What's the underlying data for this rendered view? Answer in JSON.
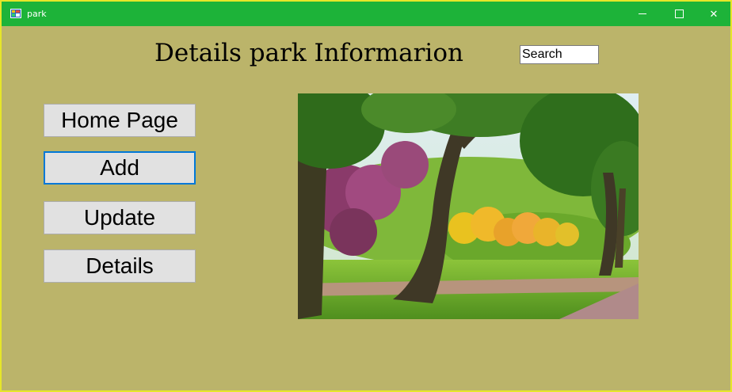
{
  "window": {
    "title": "park",
    "controls": {
      "minimize": "minimize-icon",
      "maximize": "maximize-icon",
      "close": "close-icon"
    }
  },
  "main": {
    "heading": "Details park Informarion",
    "search": {
      "value": "Search"
    },
    "buttons": {
      "home": "Home Page",
      "add": "Add",
      "update": "Update",
      "details": "Details"
    },
    "image": {
      "subject": "park-photo"
    }
  },
  "colors": {
    "titlebar": "#1db339",
    "background": "#bbb46a",
    "button": "#e1e1e1",
    "focus": "#0078d7"
  }
}
